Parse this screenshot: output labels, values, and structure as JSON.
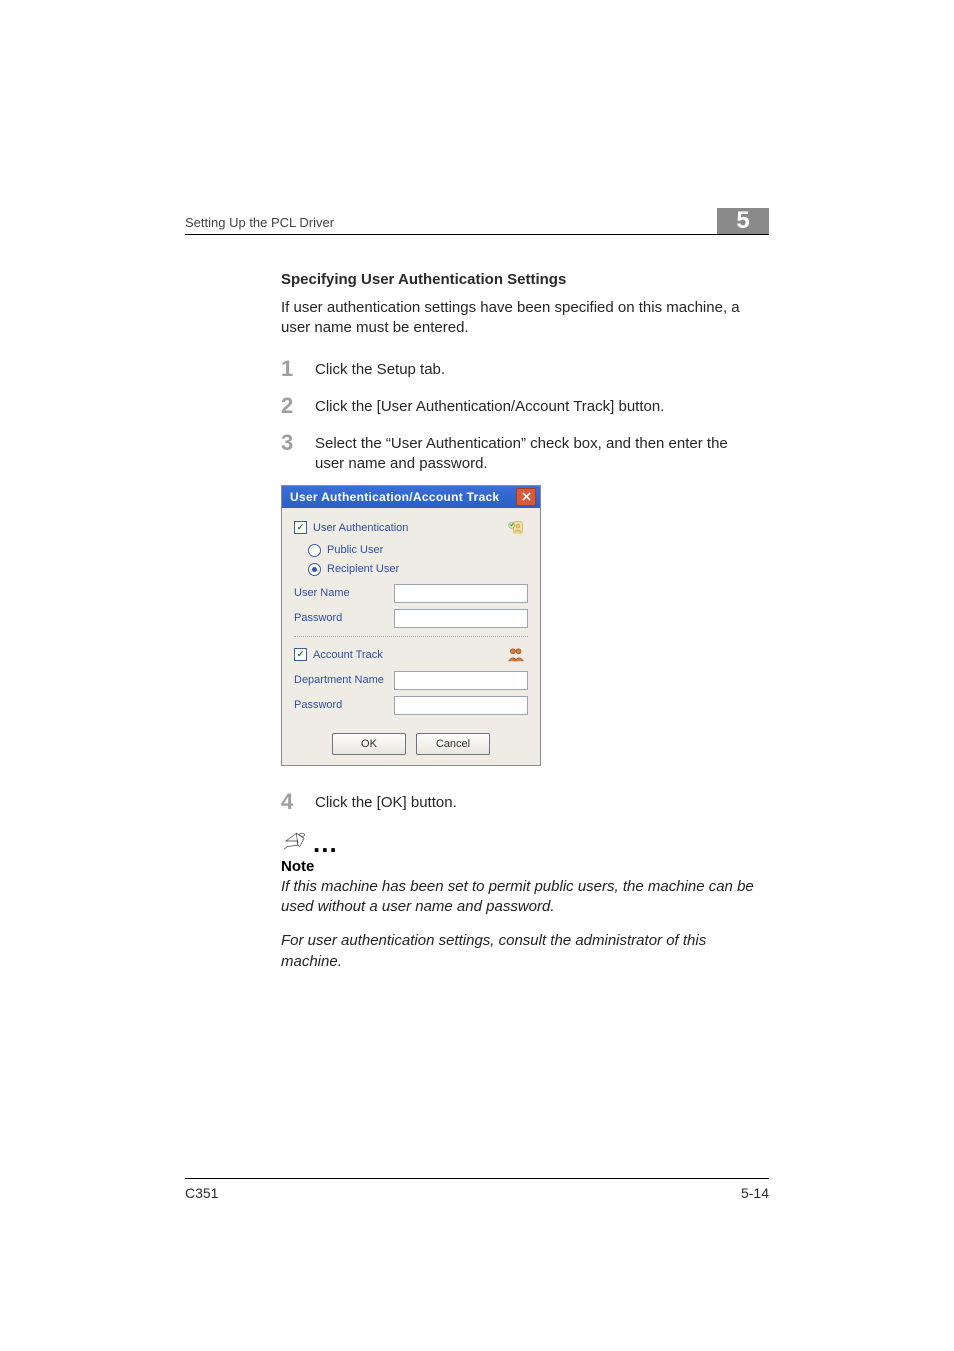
{
  "header": {
    "section": "Setting Up the PCL Driver",
    "chapter": "5"
  },
  "subheading": "Specifying User Authentication Settings",
  "intro": "If user authentication settings have been specified on this machine, a user name must be entered.",
  "steps": {
    "s1_num": "1",
    "s1": "Click the Setup tab.",
    "s2_num": "2",
    "s2": "Click the [User Authentication/Account Track] button.",
    "s3_num": "3",
    "s3": "Select the “User Authentication” check box, and then enter the user name and password.",
    "s4_num": "4",
    "s4": "Click the [OK] button."
  },
  "dialog": {
    "title": "User Authentication/Account Track",
    "userAuth": "User Authentication",
    "publicUser": "Public User",
    "recipientUser": "Recipient User",
    "userName": "User Name",
    "password": "Password",
    "accountTrack": "Account Track",
    "deptName": "Department Name",
    "atPassword": "Password",
    "ok": "OK",
    "cancel": "Cancel"
  },
  "note": {
    "dots": "...",
    "heading": "Note",
    "p1": "If this machine has been set to permit public users, the machine can be used without a user name and password.",
    "p2": "For user authentication settings, consult the administrator of this machine."
  },
  "footer": {
    "model": "C351",
    "page": "5-14"
  }
}
